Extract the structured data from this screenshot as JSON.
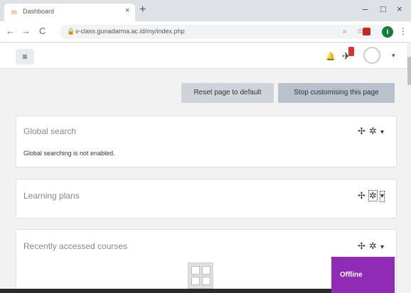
{
  "browser": {
    "tab_title": "Dashboard",
    "tab_close": "×",
    "new_tab": "+",
    "minimize": "–",
    "maximize": "□",
    "close": "×",
    "back": "←",
    "forward": "→",
    "reload": "C",
    "url": "v-class.gunadarma.ac.id/my/index.php",
    "omnibox_search_icon": "magnifier",
    "star_icon": "star",
    "profile_initial": "I",
    "menu": "⋮"
  },
  "navbar": {
    "hamburger": "≡",
    "caret": "▾"
  },
  "actions": {
    "reset_label": "Reset page to default",
    "stop_label": "Stop customising this page"
  },
  "blocks": [
    {
      "title": "Global search",
      "text": "Global searching is not enabled."
    },
    {
      "title": "Learning plans",
      "text": ""
    },
    {
      "title": "Recently accessed courses",
      "text": ""
    }
  ],
  "block_controls": {
    "move": "✢",
    "gear": "✲",
    "caret": "▾"
  },
  "offline_label": "Offline",
  "colors": {
    "offline_bg": "#8f2bb4",
    "badge": "#d9342b",
    "profile": "#1a7a3a"
  }
}
